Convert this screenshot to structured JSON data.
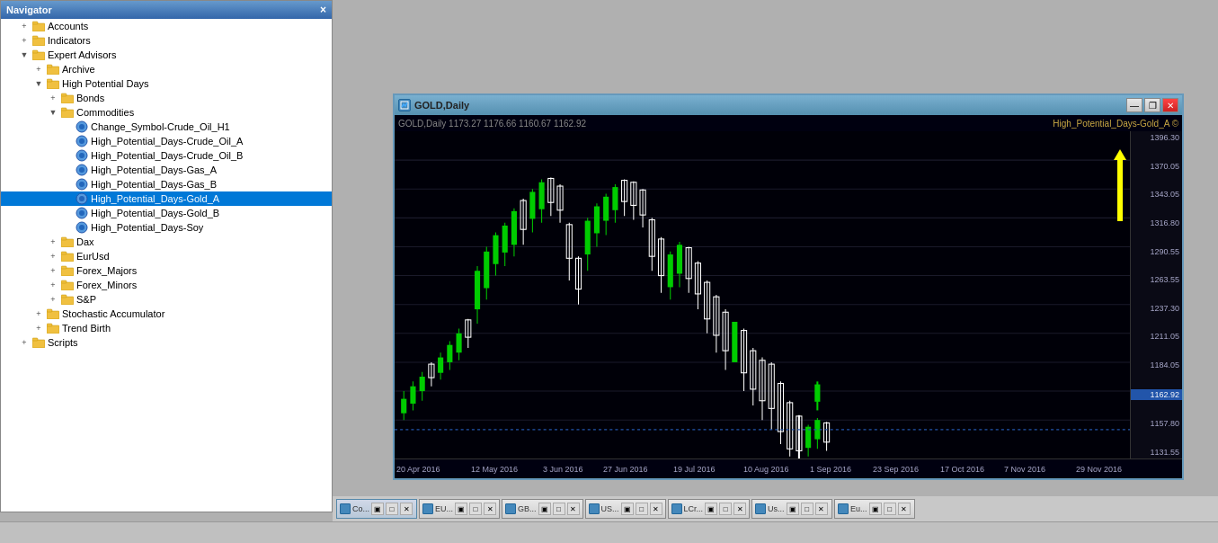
{
  "navigator": {
    "title": "Navigator",
    "close_label": "×",
    "items": [
      {
        "id": "accounts",
        "label": "Accounts",
        "indent": 1,
        "type": "folder",
        "expanded": false
      },
      {
        "id": "indicators",
        "label": "Indicators",
        "indent": 1,
        "type": "folder",
        "expanded": false
      },
      {
        "id": "expert-advisors",
        "label": "Expert Advisors",
        "indent": 1,
        "type": "folder",
        "expanded": true
      },
      {
        "id": "archive",
        "label": "Archive",
        "indent": 2,
        "type": "folder",
        "expanded": false
      },
      {
        "id": "high-potential-days",
        "label": "High Potential Days",
        "indent": 2,
        "type": "folder",
        "expanded": true
      },
      {
        "id": "bonds",
        "label": "Bonds",
        "indent": 3,
        "type": "folder",
        "expanded": false
      },
      {
        "id": "commodities",
        "label": "Commodities",
        "indent": 3,
        "type": "folder",
        "expanded": true
      },
      {
        "id": "change-symbol",
        "label": "Change_Symbol-Crude_Oil_H1",
        "indent": 4,
        "type": "script",
        "expanded": false
      },
      {
        "id": "hpd-crude-a",
        "label": "High_Potential_Days-Crude_Oil_A",
        "indent": 4,
        "type": "script",
        "expanded": false
      },
      {
        "id": "hpd-crude-b",
        "label": "High_Potential_Days-Crude_Oil_B",
        "indent": 4,
        "type": "script",
        "expanded": false
      },
      {
        "id": "hpd-gas-a",
        "label": "High_Potential_Days-Gas_A",
        "indent": 4,
        "type": "script",
        "expanded": false
      },
      {
        "id": "hpd-gas-b",
        "label": "High_Potential_Days-Gas_B",
        "indent": 4,
        "type": "script",
        "expanded": false
      },
      {
        "id": "hpd-gold-a",
        "label": "High_Potential_Days-Gold_A",
        "indent": 4,
        "type": "script",
        "expanded": false,
        "selected": true
      },
      {
        "id": "hpd-gold-b",
        "label": "High_Potential_Days-Gold_B",
        "indent": 4,
        "type": "script",
        "expanded": false
      },
      {
        "id": "hpd-soy",
        "label": "High_Potential_Days-Soy",
        "indent": 4,
        "type": "script",
        "expanded": false
      },
      {
        "id": "dax",
        "label": "Dax",
        "indent": 3,
        "type": "folder",
        "expanded": false
      },
      {
        "id": "eurusd",
        "label": "EurUsd",
        "indent": 3,
        "type": "folder",
        "expanded": false
      },
      {
        "id": "forex-majors",
        "label": "Forex_Majors",
        "indent": 3,
        "type": "folder",
        "expanded": false
      },
      {
        "id": "forex-minors",
        "label": "Forex_Minors",
        "indent": 3,
        "type": "folder",
        "expanded": false
      },
      {
        "id": "sp",
        "label": "S&P",
        "indent": 3,
        "type": "folder",
        "expanded": false
      },
      {
        "id": "stochastic",
        "label": "Stochastic Accumulator",
        "indent": 2,
        "type": "folder",
        "expanded": false
      },
      {
        "id": "trend-birth",
        "label": "Trend Birth",
        "indent": 2,
        "type": "folder",
        "expanded": false
      },
      {
        "id": "scripts",
        "label": "Scripts",
        "indent": 1,
        "type": "folder",
        "expanded": false
      }
    ]
  },
  "chart": {
    "title": "GOLD,Daily",
    "info": "GOLD,Daily  1173.27  1176.66  1160.67  1162.92",
    "indicator_label": "High_Potential_Days-Gold_A ©",
    "min_btn": "—",
    "restore_btn": "❐",
    "close_btn": "✕",
    "price_levels": [
      "1396.30",
      "1370.05",
      "1343.05",
      "1316.80",
      "1290.55",
      "1263.55",
      "1237.30",
      "1211.05",
      "1184.05",
      "1162.92",
      "1157.80",
      "1131.55"
    ],
    "time_labels": [
      {
        "label": "20 Apr 2016",
        "pos": 0
      },
      {
        "label": "12 May 2016",
        "pos": 9
      },
      {
        "label": "3 Jun 2016",
        "pos": 18
      },
      {
        "label": "27 Jun 2016",
        "pos": 25
      },
      {
        "label": "19 Jul 2016",
        "pos": 33
      },
      {
        "label": "10 Aug 2016",
        "pos": 41
      },
      {
        "label": "1 Sep 2016",
        "pos": 49
      },
      {
        "label": "23 Sep 2016",
        "pos": 56
      },
      {
        "label": "17 Oct 2016",
        "pos": 64
      },
      {
        "label": "7 Nov 2016",
        "pos": 72
      },
      {
        "label": "29 Nov 2016",
        "pos": 82
      }
    ]
  },
  "taskbar": {
    "items": [
      {
        "label": "Co...",
        "active": true
      },
      {
        "label": "EU...",
        "active": false
      },
      {
        "label": "GB...",
        "active": false
      },
      {
        "label": "US...",
        "active": false
      },
      {
        "label": "LCr...",
        "active": false
      },
      {
        "label": "Us...",
        "active": false
      },
      {
        "label": "Eu...",
        "active": false
      }
    ]
  },
  "colors": {
    "accent": "#0078d7",
    "selected_bg": "#0078d7",
    "chart_bg": "#000008",
    "candle_bull": "#00cc00",
    "candle_bear": "#ffffff",
    "price_axis_bg": "#0a0a15",
    "arrow_color": "#ffff00"
  }
}
